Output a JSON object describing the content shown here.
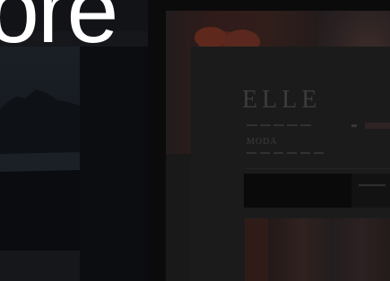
{
  "hero": {
    "word": "ore"
  },
  "site": {
    "logo": "ELLE",
    "section_title": "MODA"
  },
  "colors": {
    "background": "#0b0b0c",
    "hero_text": "#ffffff",
    "panel": "#15171b"
  }
}
